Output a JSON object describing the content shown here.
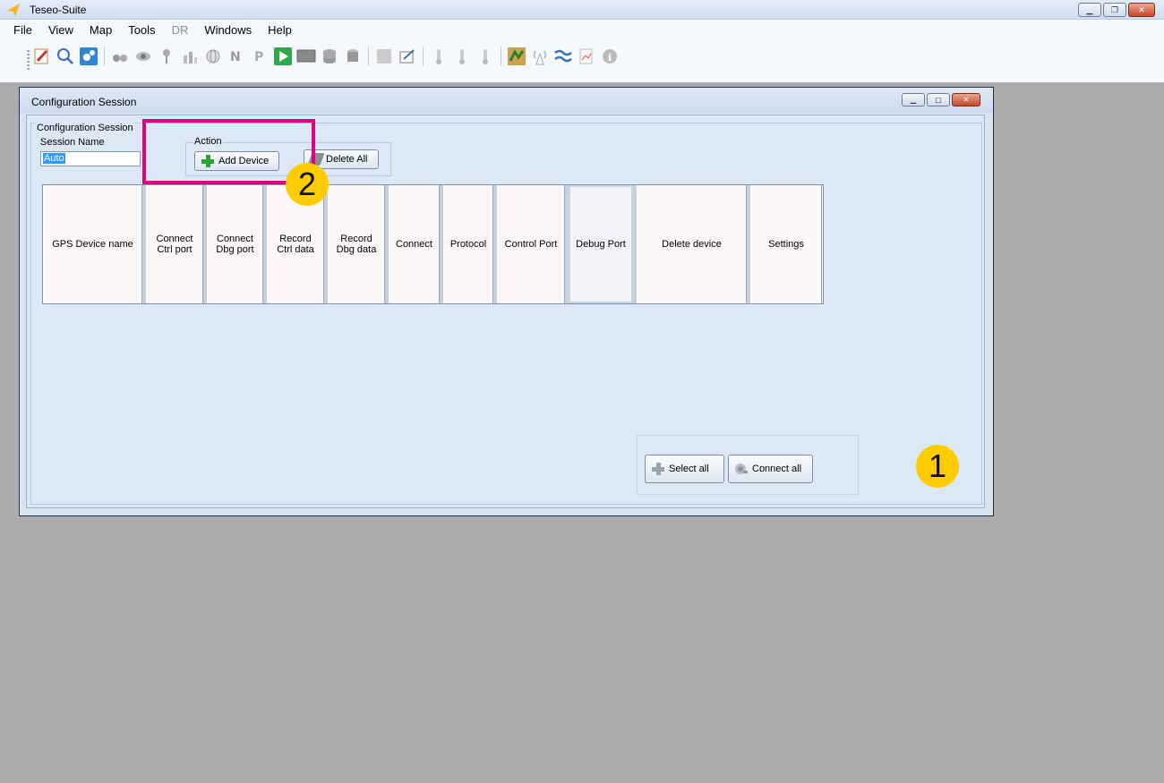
{
  "app": {
    "title": "Teseo-Suite",
    "window_buttons": [
      "minimize",
      "restore",
      "close"
    ]
  },
  "menu": [
    "File",
    "View",
    "Map",
    "Tools",
    "DR",
    "Windows",
    "Help"
  ],
  "toolbar_icons": [
    "notepad-icon",
    "search-icon",
    "settings-icon",
    "sep",
    "binocular-icon",
    "eye-icon",
    "pin-icon",
    "chart-icon",
    "globe-icon",
    "n-icon",
    "p-icon",
    "play-icon",
    "monitor-icon",
    "database-icon",
    "database2-icon",
    "sep",
    "grid-icon",
    "export-icon",
    "sep",
    "thermometer-icon",
    "thermometer-icon",
    "thermometer-icon",
    "sep",
    "map-icon",
    "antenna-icon",
    "wave-icon",
    "report-icon",
    "info-icon"
  ],
  "child_window": {
    "title": "Configuration Session",
    "group_label": "Configuration Session",
    "session_name_label": "Session Name",
    "session_name_value": "Auto",
    "action": {
      "label": "Action",
      "add_device": "Add Device",
      "delete_all": "Delete All"
    },
    "columns": [
      "GPS Device name",
      "Connect\nCtrl port",
      "Connect\nDbg port",
      "Record\nCtrl data",
      "Record\nDbg data",
      "Connect",
      "Protocol",
      "Control Port",
      "Debug Port",
      "Delete device",
      "Settings"
    ],
    "select_all": "Select all",
    "connect_all": "Connect all"
  },
  "annotations": {
    "badge_1": "1",
    "badge_2": "2",
    "highlight_color": "#e3007d",
    "badge_color": "#ffcc00"
  }
}
